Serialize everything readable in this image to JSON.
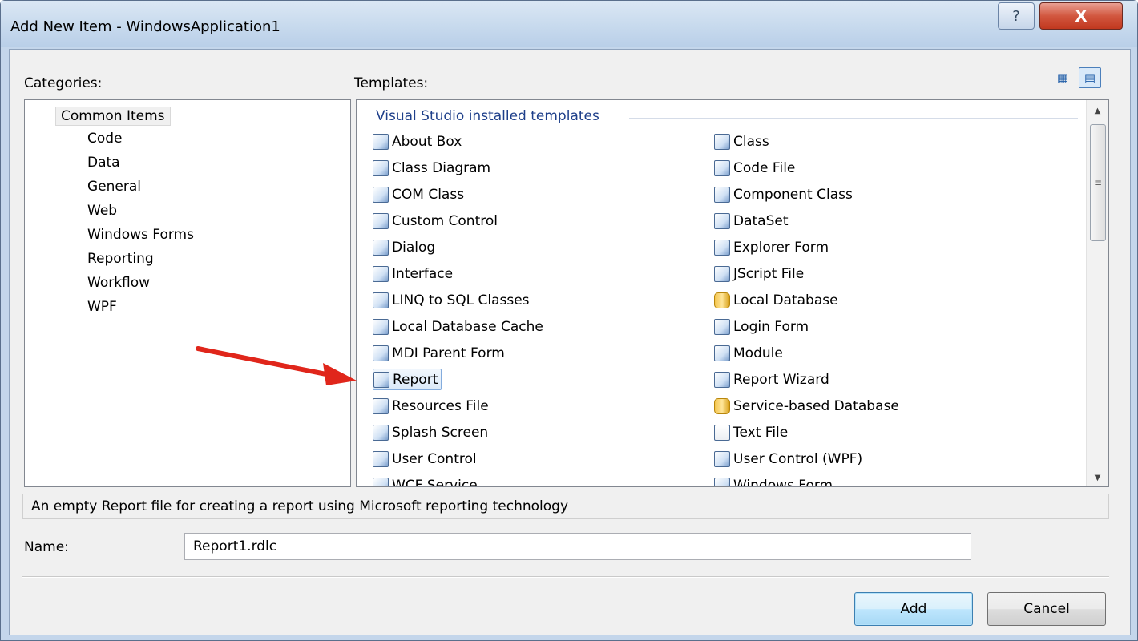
{
  "window": {
    "title": "Add New Item - WindowsApplication1",
    "help_glyph": "?",
    "close_glyph": "X"
  },
  "categories": {
    "label": "Categories:",
    "items": [
      {
        "label": "Common Items",
        "selected": true
      },
      {
        "label": "Code"
      },
      {
        "label": "Data"
      },
      {
        "label": "General"
      },
      {
        "label": "Web"
      },
      {
        "label": "Windows Forms"
      },
      {
        "label": "Reporting"
      },
      {
        "label": "Workflow"
      },
      {
        "label": "WPF"
      }
    ]
  },
  "templates": {
    "label": "Templates:",
    "group_header": "Visual Studio installed templates",
    "view_buttons": {
      "large_icons": "large-icons-view",
      "small_icons": "small-icons-view"
    },
    "left_column": [
      {
        "label": "About Box",
        "icon": "about-box-icon"
      },
      {
        "label": "Class Diagram",
        "icon": "class-diagram-icon"
      },
      {
        "label": "COM Class",
        "icon": "com-class-icon"
      },
      {
        "label": "Custom Control",
        "icon": "custom-control-icon"
      },
      {
        "label": "Dialog",
        "icon": "dialog-icon"
      },
      {
        "label": "Interface",
        "icon": "interface-icon"
      },
      {
        "label": "LINQ to SQL Classes",
        "icon": "linq-icon"
      },
      {
        "label": "Local Database Cache",
        "icon": "database-cache-icon"
      },
      {
        "label": "MDI Parent Form",
        "icon": "mdi-form-icon"
      },
      {
        "label": "Report",
        "icon": "report-icon",
        "selected": true
      },
      {
        "label": "Resources File",
        "icon": "resources-icon"
      },
      {
        "label": "Splash Screen",
        "icon": "splash-screen-icon"
      },
      {
        "label": "User Control",
        "icon": "user-control-icon"
      },
      {
        "label": "WCF Service",
        "icon": "wcf-service-icon"
      }
    ],
    "right_column": [
      {
        "label": "Class",
        "icon": "class-icon"
      },
      {
        "label": "Code File",
        "icon": "code-file-icon"
      },
      {
        "label": "Component Class",
        "icon": "component-class-icon"
      },
      {
        "label": "DataSet",
        "icon": "dataset-icon"
      },
      {
        "label": "Explorer Form",
        "icon": "explorer-form-icon"
      },
      {
        "label": "JScript File",
        "icon": "jscript-icon"
      },
      {
        "label": "Local Database",
        "icon": "database-icon"
      },
      {
        "label": "Login Form",
        "icon": "login-form-icon"
      },
      {
        "label": "Module",
        "icon": "module-icon"
      },
      {
        "label": "Report Wizard",
        "icon": "report-wizard-icon"
      },
      {
        "label": "Service-based Database",
        "icon": "database-icon"
      },
      {
        "label": "Text File",
        "icon": "text-file-icon"
      },
      {
        "label": "User Control (WPF)",
        "icon": "wpf-user-control-icon"
      },
      {
        "label": "Windows Form",
        "icon": "windows-form-icon"
      }
    ]
  },
  "description": "An empty Report file for creating a report using Microsoft reporting technology",
  "name_field": {
    "label": "Name:",
    "value": "Report1.rdlc"
  },
  "buttons": {
    "add": "Add",
    "cancel": "Cancel"
  },
  "colors": {
    "annotation_arrow": "#e0261b",
    "group_header": "#1e3f8a",
    "selection_border": "#84acdd"
  }
}
